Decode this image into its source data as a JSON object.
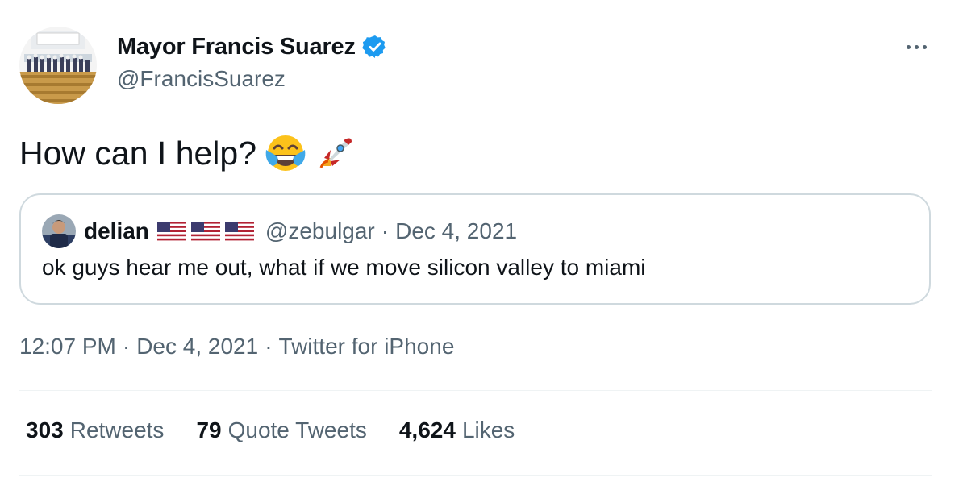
{
  "author": {
    "display_name": "Mayor Francis Suarez",
    "handle": "@FrancisSuarez",
    "verified": true,
    "verified_color": "#1d9bf0"
  },
  "tweet": {
    "text": "How can I help?",
    "emojis": [
      "face-with-tears-of-joy-emoji",
      "rocket-emoji"
    ]
  },
  "quoted_tweet": {
    "display_name": "delian",
    "flags": [
      "us-flag-emoji",
      "us-flag-emoji",
      "us-flag-emoji"
    ],
    "handle": "@zebulgar",
    "separator": "·",
    "date": "Dec 4, 2021",
    "text": "ok guys hear me out, what if we move silicon valley to miami"
  },
  "meta": {
    "time": "12:07 PM",
    "separator": "·",
    "date": "Dec 4, 2021",
    "source": "Twitter for iPhone"
  },
  "stats": [
    {
      "count": "303",
      "label": "Retweets"
    },
    {
      "count": "79",
      "label": "Quote Tweets"
    },
    {
      "count": "4,624",
      "label": "Likes"
    }
  ],
  "colors": {
    "text_primary": "#0f1419",
    "text_secondary": "#536471",
    "border": "#cfd9de",
    "divider": "#eff3f4"
  }
}
